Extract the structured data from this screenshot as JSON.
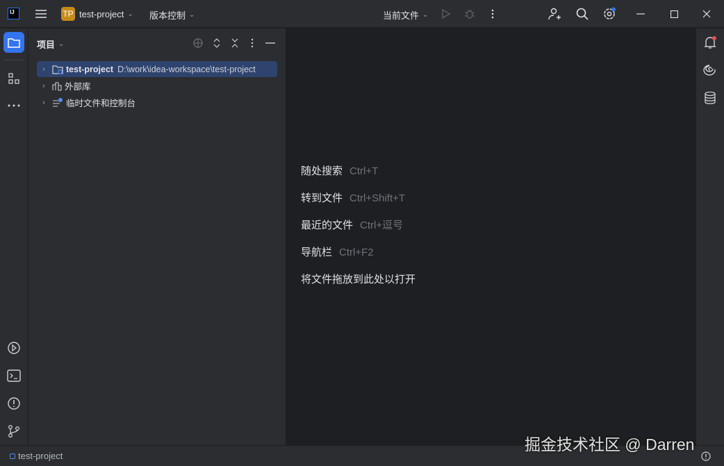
{
  "titlebar": {
    "logo": "IJ",
    "project_badge": "TP",
    "project_name": "test-project",
    "vcs_label": "版本控制",
    "run_config": "当前文件",
    "colors": {
      "badge": "#c78b1a",
      "accent": "#3574f0",
      "notification": "#e05555"
    }
  },
  "panel": {
    "title": "项目",
    "tree": [
      {
        "name": "test-project",
        "path": "D:\\work\\idea-workspace\\test-project",
        "selected": true,
        "icon": "folder-icon"
      },
      {
        "name": "外部库",
        "icon": "library-icon"
      },
      {
        "name": "临时文件和控制台",
        "icon": "scratches-icon"
      }
    ]
  },
  "editor": {
    "hints": [
      {
        "label": "随处搜索",
        "shortcut": "Ctrl+T"
      },
      {
        "label": "转到文件",
        "shortcut": "Ctrl+Shift+T"
      },
      {
        "label": "最近的文件",
        "shortcut": "Ctrl+逗号"
      },
      {
        "label": "导航栏",
        "shortcut": "Ctrl+F2"
      },
      {
        "label": "将文件拖放到此处以打开",
        "shortcut": ""
      }
    ]
  },
  "statusbar": {
    "project": "test-project"
  },
  "watermark": "掘金技术社区 @ Darren"
}
